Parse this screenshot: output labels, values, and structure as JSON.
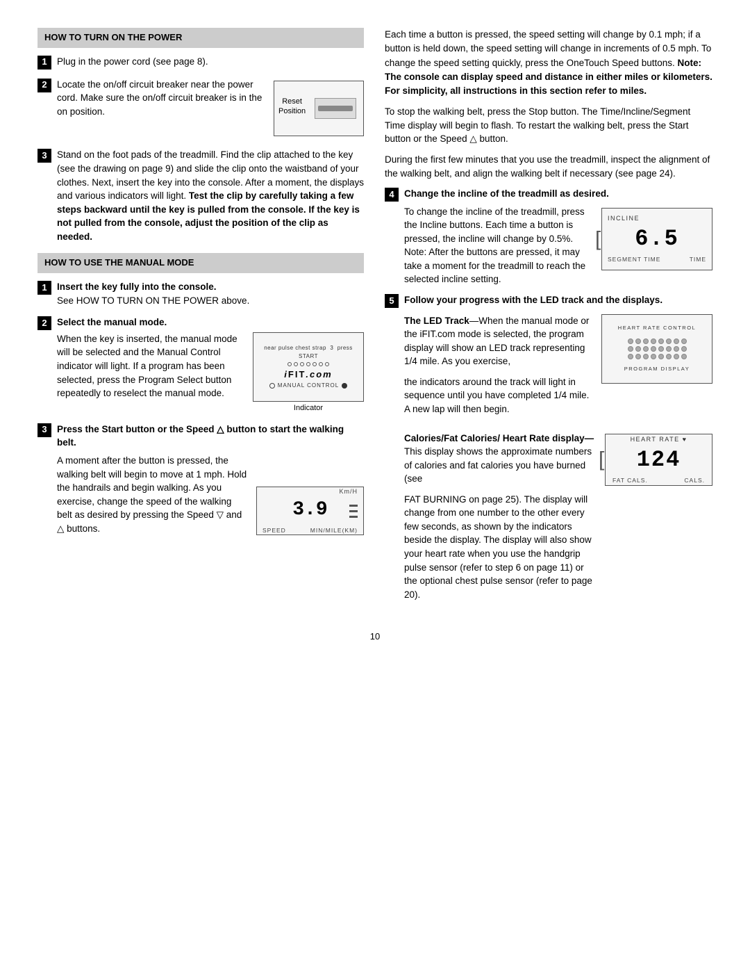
{
  "page": {
    "number": "10"
  },
  "left_col": {
    "section1": {
      "header": "HOW TO TURN ON THE POWER",
      "steps": [
        {
          "num": "1",
          "text": "Plug in the power cord (see page 8)."
        },
        {
          "num": "2",
          "text_before": "Locate the on/off circuit breaker near the power cord. Make sure the on/off circuit breaker is in the on position.",
          "device_label_line1": "Reset",
          "device_label_line2": "Position"
        },
        {
          "num": "3",
          "text": "Stand on the foot pads of the treadmill. Find the clip attached to the key (see the drawing on page 9) and slide the clip onto the waistband of your clothes. Next, insert the key into the console. After a moment, the displays and various indicators will light.",
          "bold_text": "Test the clip by carefully taking a few steps backward until the key is pulled from the console. If the key is not pulled from the console, adjust the position of the clip as needed."
        }
      ]
    },
    "section2": {
      "header": "HOW TO USE THE MANUAL MODE",
      "steps": [
        {
          "num": "1",
          "bold_label": "Insert the key fully into the console.",
          "text": "See HOW TO TURN ON THE POWER above."
        },
        {
          "num": "2",
          "bold_label": "Select the manual mode.",
          "text_parts": [
            "When the key is inserted, the manual mode will be selected and the Manual Control indicator will light. If a program has been selected, press the Program Select button repeatedly to reselect the manual mode."
          ],
          "device_text1": "near pulse chest strap 3 press START",
          "device_ifit": "iFIT.com",
          "device_manual": "MANUAL CONTROL",
          "device_indicator": "Indicator"
        },
        {
          "num": "3",
          "bold_label": "Press the Start button or the Speed △ button to start the walking belt.",
          "text_main": "A moment after the button is pressed, the walking belt will begin to move at 1 mph. Hold the handrails and begin walking. As you exercise, change the speed of the walking belt as desired by pressing the Speed ▽ and △ buttons.",
          "device_kmh": "Km/H",
          "device_num": "3.9",
          "device_speed": "SPEED",
          "device_min": "MIN/MILE(km)"
        }
      ]
    }
  },
  "right_col": {
    "intro_paragraphs": [
      "Each time a button is pressed, the speed setting will change by 0.1 mph; if a button is held down, the speed setting will change in increments of 0.5 mph. To change the speed setting quickly, press the OneTouch Speed buttons.",
      "Note: The console can display speed and distance in either miles or kilometers. For simplicity, all instructions in this section refer to miles.",
      "To stop the walking belt, press the Stop button. The Time/Incline/Segment Time display will begin to flash. To restart the walking belt, press the Start button or the Speed △ button.",
      "During the first few minutes that you use the treadmill, inspect the alignment of the walking belt, and align the walking belt if necessary (see page 24)."
    ],
    "note_bold": "Note: The console can display speed and distance in either miles or kilometers. For simplicity, all instructions in this section refer to miles.",
    "step4": {
      "num": "4",
      "bold_label": "Change the incline of the treadmill as desired.",
      "text": "To change the incline of the treadmill, press the Incline buttons. Each time a button is pressed, the incline will change by 0.5%. Note: After the buttons are pressed, it may take a moment for the treadmill to reach the selected incline setting.",
      "device_incline_label": "INCLINE",
      "device_num": "6.5",
      "device_seg_label": "SEGMENT TIME",
      "device_time_label": "TIME"
    },
    "step5": {
      "num": "5",
      "bold_label": "Follow your progress with the LED track and the displays.",
      "subsections": {
        "led_track": {
          "title_bold": "The LED Track",
          "title_rest": "—When the manual mode or the iFIT.com mode is selected, the program display will show an LED track representing 1/4 mile. As you exercise, the indicators around the track will light in sequence until you have completed 1/4 mile. A new lap will then begin.",
          "device_label_top": "HEART RATE CONTROL",
          "device_label_bottom": "PROGRAM DISPLAY"
        },
        "calories": {
          "title_bold": "Calories/Fat Calories/ Heart Rate display—",
          "text": "This display shows the approximate numbers of calories and fat calories you have burned (see FAT BURNING on page 25). The display will change from one number to the other every few seconds, as shown by the indicators beside the display. The display will also show your heart rate when you use the handgrip pulse sensor (refer to step 6 on page 11) or the optional chest pulse sensor (refer to page 20).",
          "device_label_top": "HEART RATE ♥",
          "device_num": "124",
          "device_fat": "FAT CALS.",
          "device_cals": "CALS."
        }
      }
    }
  }
}
